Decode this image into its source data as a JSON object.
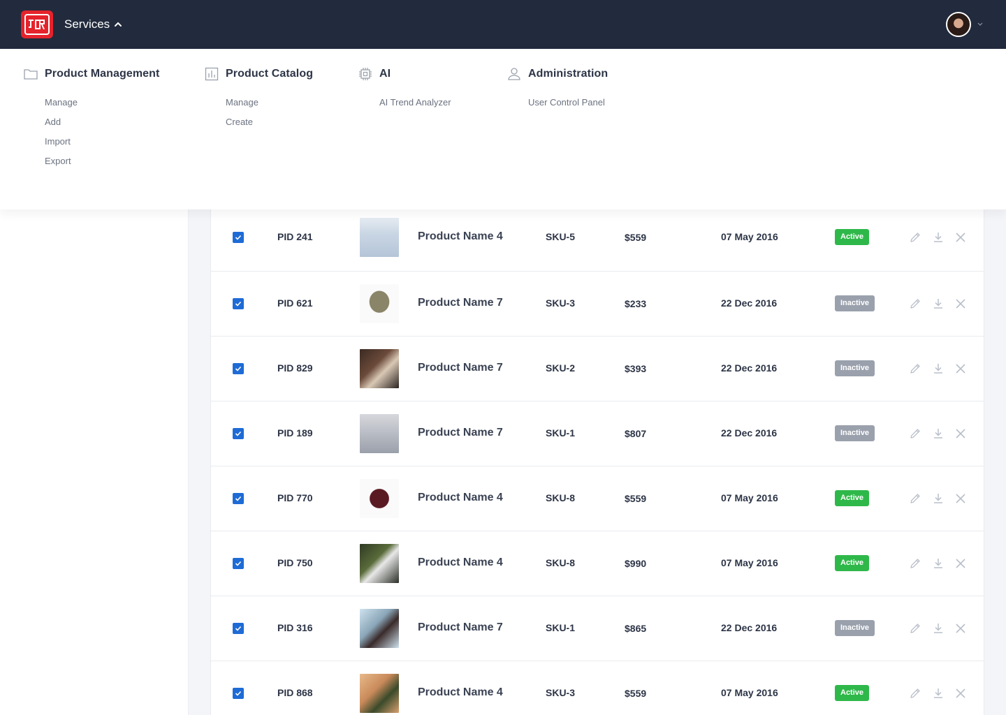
{
  "header": {
    "logo_text": "JCR",
    "services_label": "Services",
    "colors": {
      "topbar": "#222b3d",
      "logo": "#e5232c"
    }
  },
  "menu": {
    "columns": [
      {
        "icon": "folder-icon",
        "title": "Product Management",
        "items": [
          "Manage",
          "Add",
          "Import",
          "Export"
        ]
      },
      {
        "icon": "bar-chart-icon",
        "title": "Product Catalog",
        "items": [
          "Manage",
          "Create"
        ]
      },
      {
        "icon": "cpu-chip-icon",
        "title": "AI",
        "items": [
          "AI Trend Analyzer"
        ]
      },
      {
        "icon": "user-icon",
        "title": "Administration",
        "items": [
          "User Control Panel"
        ]
      }
    ]
  },
  "table": {
    "rows": [
      {
        "checked": true,
        "pid": "PID 241",
        "image": "product-photo-light-shirt",
        "name": "Product Name 4",
        "sku": "SKU-5",
        "price": "$559",
        "date": "07 May 2016",
        "status": "Active"
      },
      {
        "checked": true,
        "pid": "PID 621",
        "image": "product-photo-olive-tee",
        "name": "Product Name 7",
        "sku": "SKU-3",
        "price": "$233",
        "date": "22 Dec 2016",
        "status": "Inactive"
      },
      {
        "checked": true,
        "pid": "PID 829",
        "image": "product-photo-dark-portrait",
        "name": "Product Name 7",
        "sku": "SKU-2",
        "price": "$393",
        "date": "22 Dec 2016",
        "status": "Inactive"
      },
      {
        "checked": true,
        "pid": "PID 189",
        "image": "product-photo-grey-shirt",
        "name": "Product Name 7",
        "sku": "SKU-1",
        "price": "$807",
        "date": "22 Dec 2016",
        "status": "Inactive"
      },
      {
        "checked": true,
        "pid": "PID 770",
        "image": "product-photo-maroon-polo",
        "name": "Product Name 4",
        "sku": "SKU-8",
        "price": "$559",
        "date": "07 May 2016",
        "status": "Active"
      },
      {
        "checked": true,
        "pid": "PID 750",
        "image": "product-photo-graphic-tee",
        "name": "Product Name 4",
        "sku": "SKU-8",
        "price": "$990",
        "date": "07 May 2016",
        "status": "Active"
      },
      {
        "checked": true,
        "pid": "PID 316",
        "image": "product-photo-patterned-shirt",
        "name": "Product Name 7",
        "sku": "SKU-1",
        "price": "$865",
        "date": "22 Dec 2016",
        "status": "Inactive"
      },
      {
        "checked": true,
        "pid": "PID 868",
        "image": "product-photo-floral-shirt",
        "name": "Product Name 4",
        "sku": "SKU-3",
        "price": "$559",
        "date": "07 May 2016",
        "status": "Active"
      }
    ],
    "colors": {
      "active": "#2fb84a",
      "inactive": "#9aa1ad",
      "checkbox": "#1e6bd6"
    }
  }
}
